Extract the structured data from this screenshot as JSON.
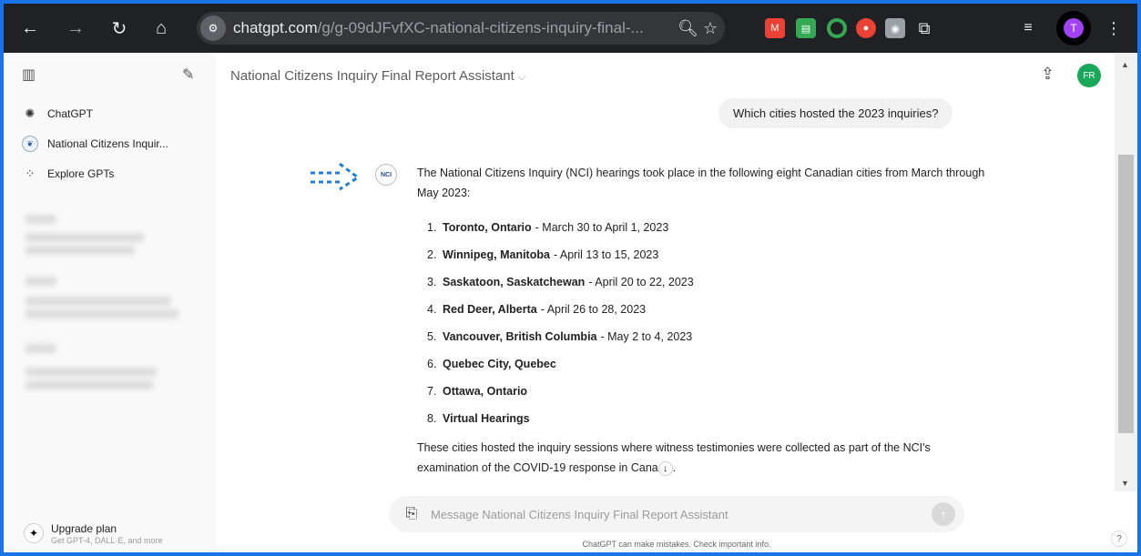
{
  "browser": {
    "url_domain": "chatgpt.com",
    "url_path": "/g/g-09dJFvfXC-national-citizens-inquiry-final-...",
    "profile_initial": "T"
  },
  "sidebar": {
    "items": [
      {
        "label": "ChatGPT",
        "icon": "openai-logo-icon"
      },
      {
        "label": "National Citizens Inquir...",
        "icon": "nci-logo-icon"
      },
      {
        "label": "Explore GPTs",
        "icon": "grid-icon"
      }
    ],
    "upgrade": {
      "label": "Upgrade plan",
      "sublabel": "Get GPT-4, DALL·E, and more"
    }
  },
  "header": {
    "title": "National Citizens Inquiry Final Report Assistant",
    "user_initials": "FR"
  },
  "conversation": {
    "user_message": "Which cities hosted the 2023 inquiries?",
    "answer_intro": "The National Citizens Inquiry (NCI) hearings took place in the following eight Canadian cities from March through May 2023:",
    "cities": [
      {
        "num": "1.",
        "name": "Toronto, Ontario",
        "dates": "- March 30 to April 1, 2023"
      },
      {
        "num": "2.",
        "name": "Winnipeg, Manitoba",
        "dates": "- April 13 to 15, 2023"
      },
      {
        "num": "3.",
        "name": "Saskatoon, Saskatchewan",
        "dates": "- April 20 to 22, 2023"
      },
      {
        "num": "4.",
        "name": "Red Deer, Alberta",
        "dates": "- April 26 to 28, 2023"
      },
      {
        "num": "5.",
        "name": "Vancouver, British Columbia",
        "dates": "- May 2 to 4, 2023"
      },
      {
        "num": "6.",
        "name": "Quebec City, Quebec",
        "dates": ""
      },
      {
        "num": "7.",
        "name": "Ottawa, Ontario",
        "dates": ""
      },
      {
        "num": "8.",
        "name": "Virtual Hearings",
        "dates": ""
      }
    ],
    "answer_outro": "These cities hosted the inquiry sessions where witness testimonies were collected as part of the NCI's examination of the COVID-19 response in Cana",
    "answer_outro_tail": "."
  },
  "composer": {
    "placeholder": "Message National Citizens Inquiry Final Report Assistant"
  },
  "disclaimer": "ChatGPT can make mistakes. Check important info.",
  "help_label": "?",
  "colors": {
    "accent_user": "#19a85a",
    "profile": "#a142f4",
    "frame": "#1a73e8"
  }
}
